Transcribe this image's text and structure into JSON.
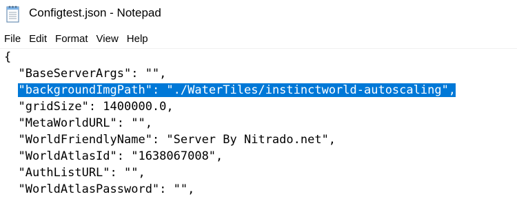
{
  "window": {
    "title": "Configtest.json - Notepad",
    "icon": "notepad-icon"
  },
  "menu": [
    {
      "label": "File"
    },
    {
      "label": "Edit"
    },
    {
      "label": "Format"
    },
    {
      "label": "View"
    },
    {
      "label": "Help"
    }
  ],
  "editor": {
    "lines": [
      "{",
      "  \"BaseServerArgs\": \"\",",
      "  \"backgroundImgPath\": \"./WaterTiles/instinctworld-autoscaling\",",
      "  \"gridSize\": 1400000.0,",
      "  \"MetaWorldURL\": \"\",",
      "  \"WorldFriendlyName\": \"Server By Nitrado.net\",",
      "  \"WorldAtlasId\": \"1638067008\",",
      "  \"AuthListURL\": \"\",",
      "  \"WorldAtlasPassword\": \"\","
    ],
    "selected_line": 2,
    "selection_color": "#0078d7"
  }
}
